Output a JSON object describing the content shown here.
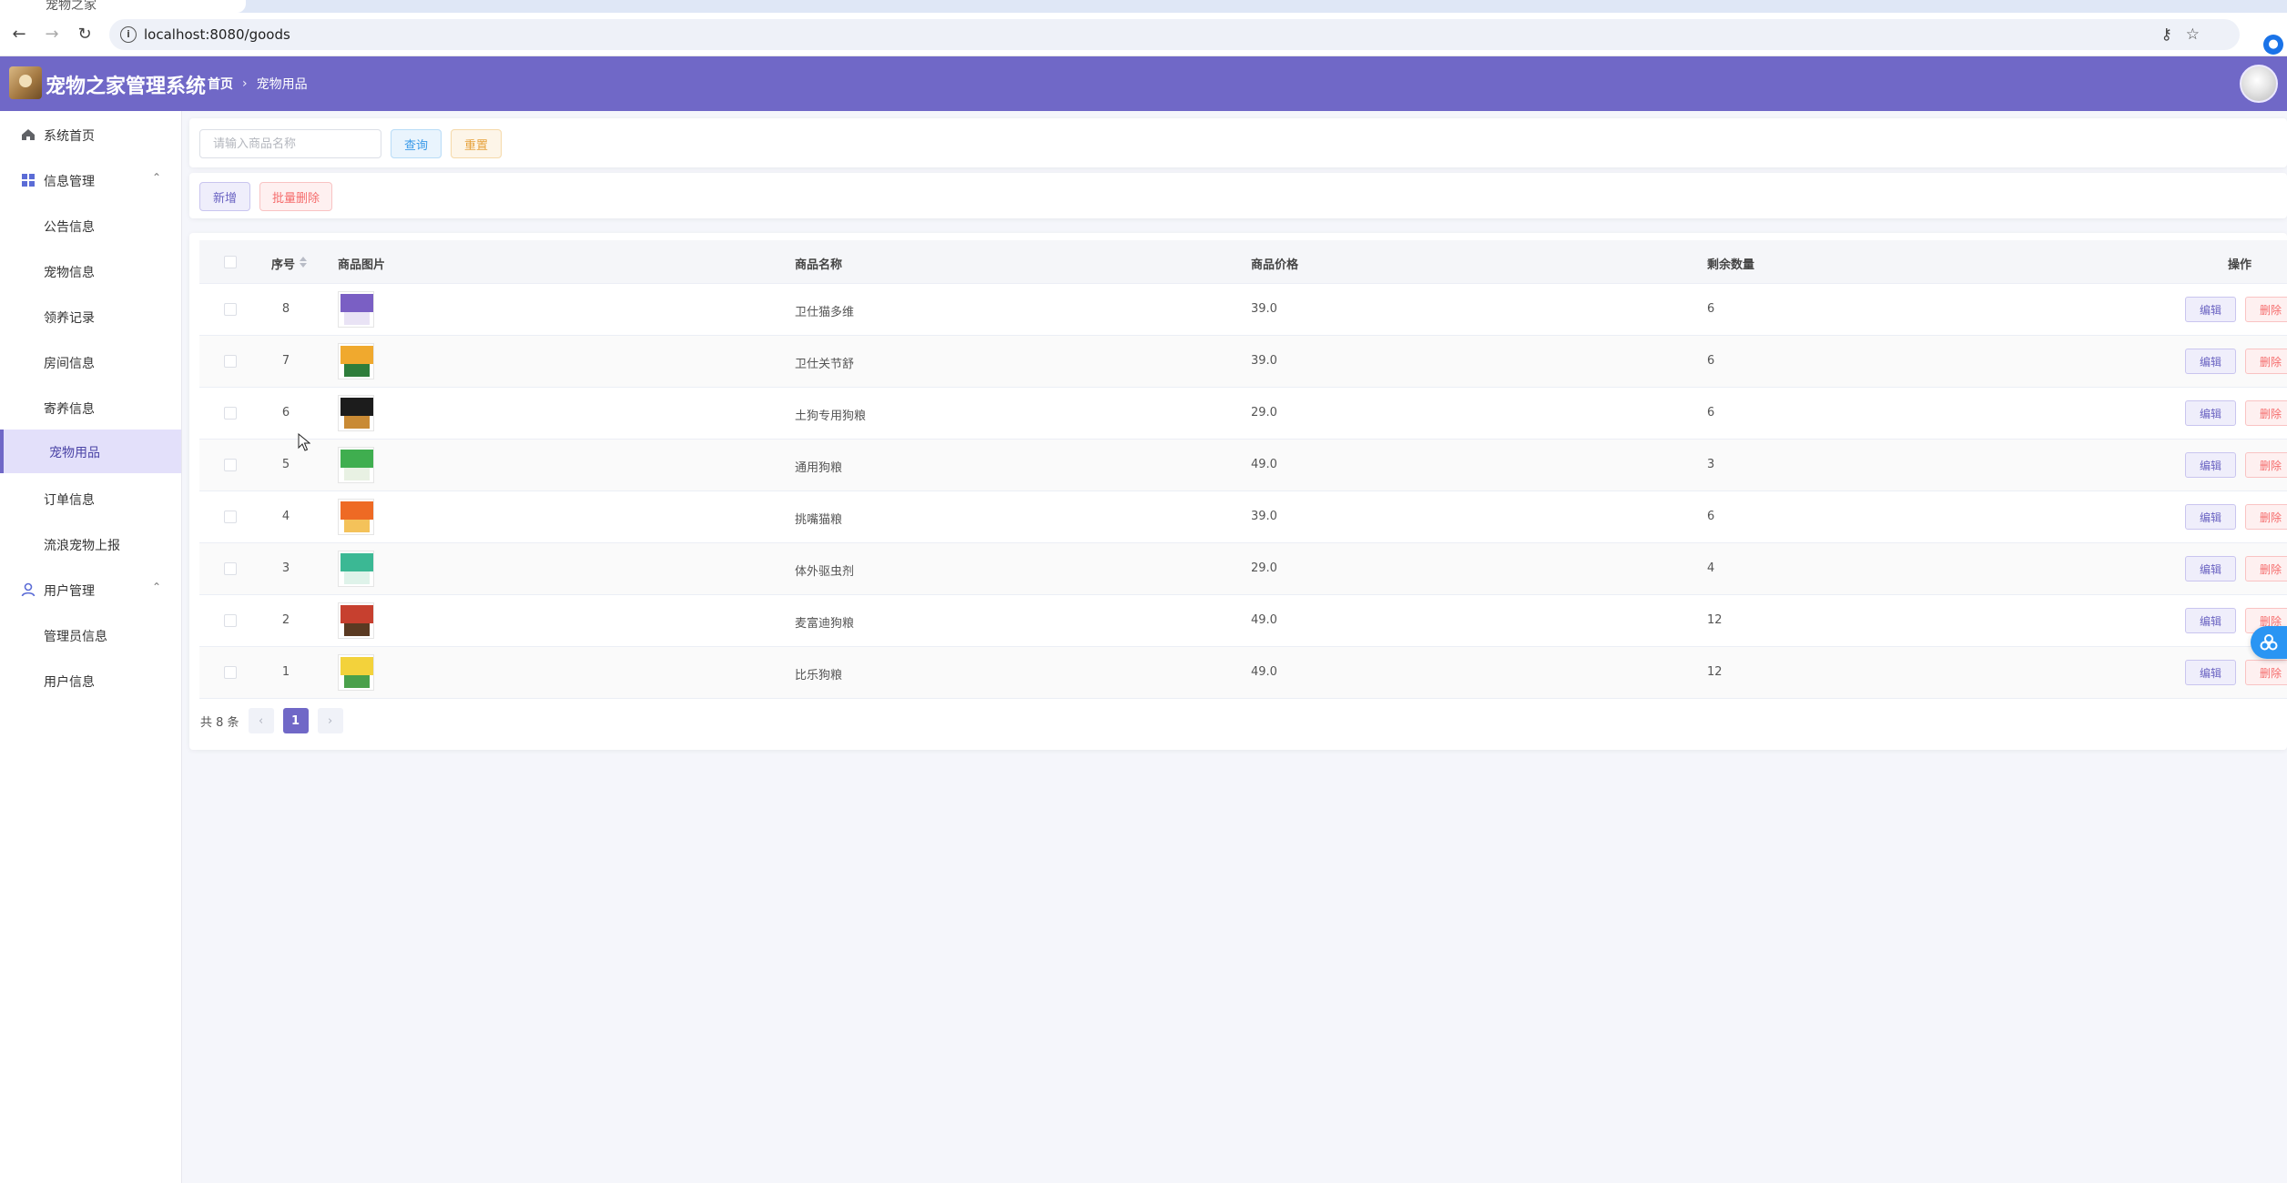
{
  "browser": {
    "tab_title": "宠物之家",
    "url": "localhost:8080/goods"
  },
  "header": {
    "app_title": "宠物之家管理系统",
    "breadcrumb": [
      "首页",
      "宠物用品"
    ]
  },
  "sidebar": {
    "items": [
      {
        "label": "系统首页",
        "icon": "home-icon",
        "type": "top"
      },
      {
        "label": "信息管理",
        "icon": "grid-icon",
        "type": "group"
      },
      {
        "label": "公告信息",
        "type": "sub"
      },
      {
        "label": "宠物信息",
        "type": "sub"
      },
      {
        "label": "领养记录",
        "type": "sub"
      },
      {
        "label": "房间信息",
        "type": "sub"
      },
      {
        "label": "寄养信息",
        "type": "sub"
      },
      {
        "label": "宠物用品",
        "type": "sub",
        "active": true
      },
      {
        "label": "订单信息",
        "type": "sub"
      },
      {
        "label": "流浪宠物上报",
        "type": "sub"
      },
      {
        "label": "用户管理",
        "icon": "user-icon",
        "type": "group"
      },
      {
        "label": "管理员信息",
        "type": "sub"
      },
      {
        "label": "用户信息",
        "type": "sub"
      }
    ]
  },
  "search": {
    "placeholder": "请输入商品名称",
    "query_label": "查询",
    "reset_label": "重置"
  },
  "actions": {
    "add_label": "新增",
    "batch_delete_label": "批量删除"
  },
  "table": {
    "columns": [
      "序号",
      "商品图片",
      "商品名称",
      "商品价格",
      "剩余数量",
      "操作"
    ],
    "edit_label": "编辑",
    "delete_label": "删除",
    "rows": [
      {
        "id": "8",
        "name": "卫仕猫多维",
        "price": "39.0",
        "stock": "6",
        "thumb": [
          "#7a5fc4",
          "#e9e3f5"
        ]
      },
      {
        "id": "7",
        "name": "卫仕关节舒",
        "price": "39.0",
        "stock": "6",
        "thumb": [
          "#f0a92e",
          "#2e7d3b"
        ]
      },
      {
        "id": "6",
        "name": "土狗专用狗粮",
        "price": "29.0",
        "stock": "6",
        "thumb": [
          "#1c1c1c",
          "#c98a34"
        ]
      },
      {
        "id": "5",
        "name": "通用狗粮",
        "price": "49.0",
        "stock": "3",
        "thumb": [
          "#3fae4f",
          "#e8f1e3"
        ]
      },
      {
        "id": "4",
        "name": "挑嘴猫粮",
        "price": "39.0",
        "stock": "6",
        "thumb": [
          "#ee6a24",
          "#f4c25a"
        ]
      },
      {
        "id": "3",
        "name": "体外驱虫剂",
        "price": "29.0",
        "stock": "4",
        "thumb": [
          "#3bb894",
          "#dff3ea"
        ]
      },
      {
        "id": "2",
        "name": "麦富迪狗粮",
        "price": "49.0",
        "stock": "12",
        "thumb": [
          "#c7402f",
          "#5a3a22"
        ]
      },
      {
        "id": "1",
        "name": "比乐狗粮",
        "price": "49.0",
        "stock": "12",
        "thumb": [
          "#f3d23b",
          "#4aa04b"
        ]
      }
    ]
  },
  "pagination": {
    "total_text": "共 8 条",
    "current_page": "1"
  },
  "colors": {
    "brand": "#7068c7",
    "primary_info": "#3a9ae8",
    "warning": "#e6a23c",
    "danger": "#f56c6c"
  }
}
